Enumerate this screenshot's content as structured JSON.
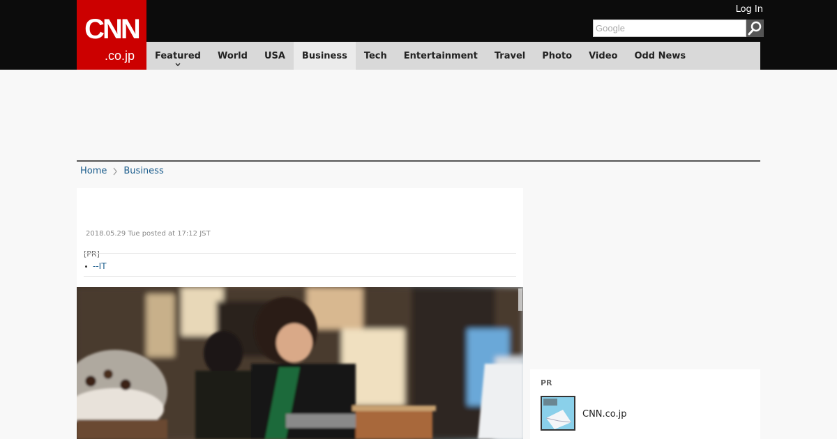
{
  "header": {
    "logo_main": "CNN",
    "logo_sub": ".co.jp",
    "login_label": "Log In",
    "search_placeholder": "Google"
  },
  "nav": {
    "items": [
      {
        "label": "Featured"
      },
      {
        "label": "World"
      },
      {
        "label": "USA"
      },
      {
        "label": "Business"
      },
      {
        "label": "Tech"
      },
      {
        "label": "Entertainment"
      },
      {
        "label": "Travel"
      },
      {
        "label": "Photo"
      },
      {
        "label": "Video"
      },
      {
        "label": "Odd News"
      }
    ],
    "active_index": 3
  },
  "breadcrumb": {
    "home": "Home",
    "current": "Business"
  },
  "article": {
    "dateline": "2018.05.29 Tue posted at 17:12 JST",
    "pr_label": "[PR]",
    "pr_link": "--IT"
  },
  "sidebar": {
    "pr_title": "PR",
    "pr_item_name": "CNN.co.jp"
  },
  "colors": {
    "brand_red": "#cc0000",
    "topbar": "#0c0c0c",
    "nav_bg": "#d9d9d9",
    "link": "#1a5c8c"
  }
}
